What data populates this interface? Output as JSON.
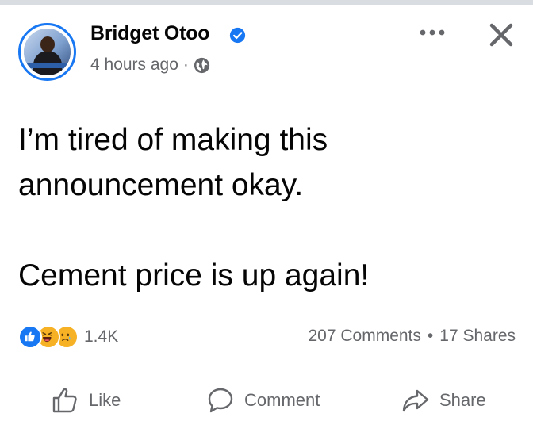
{
  "post": {
    "author": "Bridget Otoo",
    "verified": true,
    "time": "4 hours ago",
    "separator": "·",
    "audience_icon": "globe-icon",
    "text_lines": [
      "I’m tired of making this announcement okay.",
      "Cement price is up again!"
    ]
  },
  "reactions": {
    "types": [
      "like-icon",
      "haha-icon",
      "sad-icon"
    ],
    "count": "1.4K"
  },
  "stats": {
    "comments": "207 Comments",
    "separator": "•",
    "shares": "17 Shares"
  },
  "actions": {
    "like": "Like",
    "comment": "Comment",
    "share": "Share"
  },
  "colors": {
    "accent": "#1877f2",
    "secondary_text": "#65676b",
    "primary_text": "#050505",
    "divider": "#ced0d4"
  }
}
